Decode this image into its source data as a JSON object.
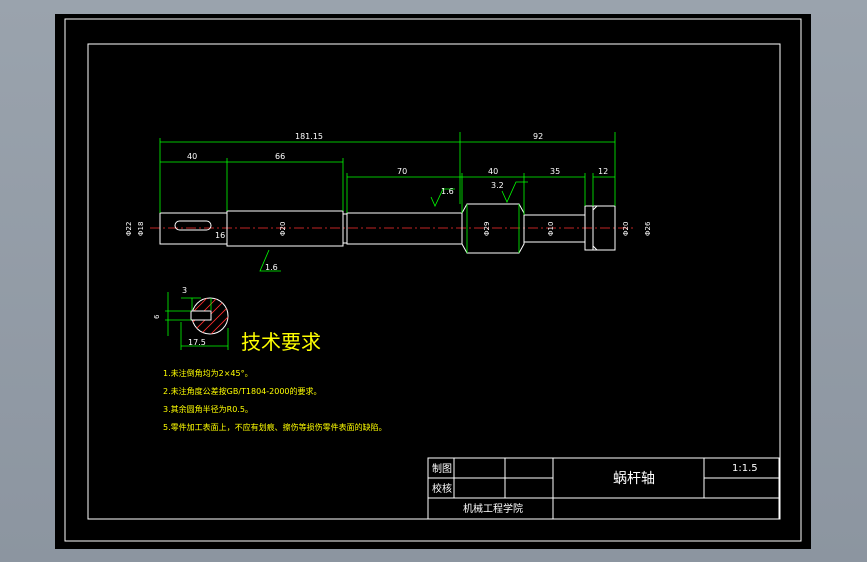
{
  "dimensions": {
    "overall_left": "181.15",
    "overall_right": "92",
    "seg_40a": "40",
    "seg_66": "66",
    "seg_70": "70",
    "seg_40b": "40",
    "seg_35": "35",
    "seg_12": "12",
    "roughness_1": "1.6",
    "roughness_2": "3.2",
    "roughness_3": "1.6",
    "dia_22": "Φ22",
    "dia_18": "Φ18",
    "dia_20a": "Φ20",
    "dia_29": "Φ29",
    "dia_10": "Φ10",
    "dia_20b": "Φ20",
    "dia_26": "Φ26",
    "key_len": "16"
  },
  "section": {
    "dim_top": "3",
    "dim_left": "6",
    "dim_bottom": "17.5"
  },
  "tech_requirements": {
    "title": "技术要求",
    "items": [
      "1.未注倒角均为2×45°。",
      "2.未注角度公差按GB/T1804-2000的要求。",
      "3.其余圆角半径为R0.5。",
      "5.零件加工表面上，不应有划痕、擦伤等损伤零件表面的缺陷。"
    ]
  },
  "title_block": {
    "drawn_label": "制图",
    "checked_label": "校核",
    "part_name": "蜗杆轴",
    "scale": "1:1.5",
    "school": "机械工程学院"
  }
}
